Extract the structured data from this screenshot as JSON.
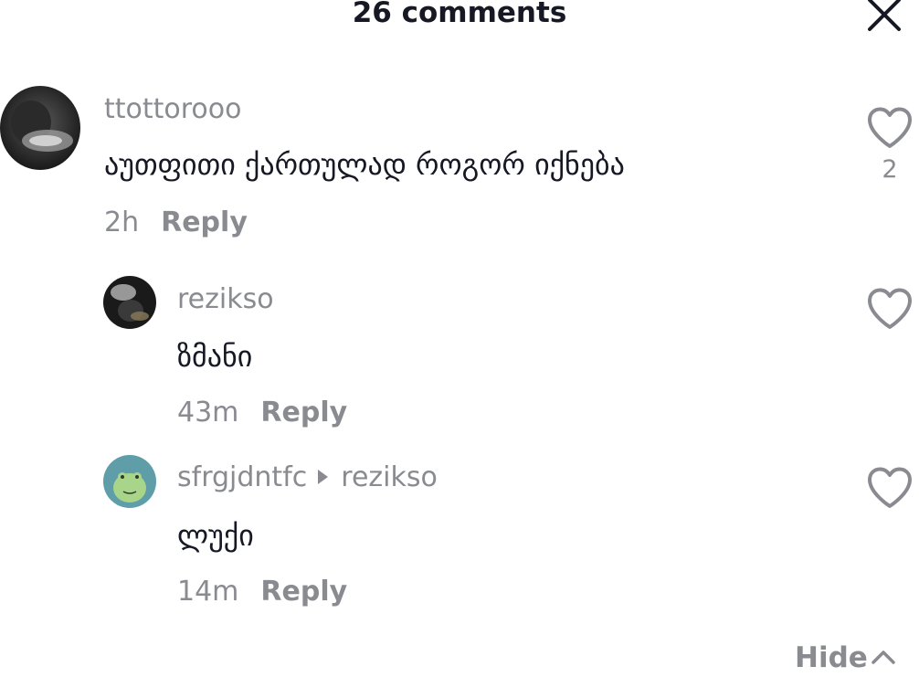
{
  "header": {
    "title": "26 comments",
    "close_icon": "close-icon"
  },
  "comments": [
    {
      "username": "ttottorooo",
      "text": "აუთფითი ქართულად როგორ იქნება",
      "time": "2h",
      "reply_label": "Reply",
      "like_count": "2",
      "avatar": "dark-photo-avatar"
    },
    {
      "username": "rezikso",
      "text": "ზმანი",
      "time": "43m",
      "reply_label": "Reply",
      "avatar": "smoke-photo-avatar"
    },
    {
      "username": "sfrgjdntfc",
      "reply_to": "rezikso",
      "text": "ლუქი",
      "time": "14m",
      "reply_label": "Reply",
      "avatar": "green-frog-avatar"
    }
  ],
  "footer": {
    "hide_label": "Hide"
  },
  "colors": {
    "text": "#161823",
    "muted": "#8a8b91",
    "icon": "#8a8b91",
    "background": "#ffffff"
  }
}
